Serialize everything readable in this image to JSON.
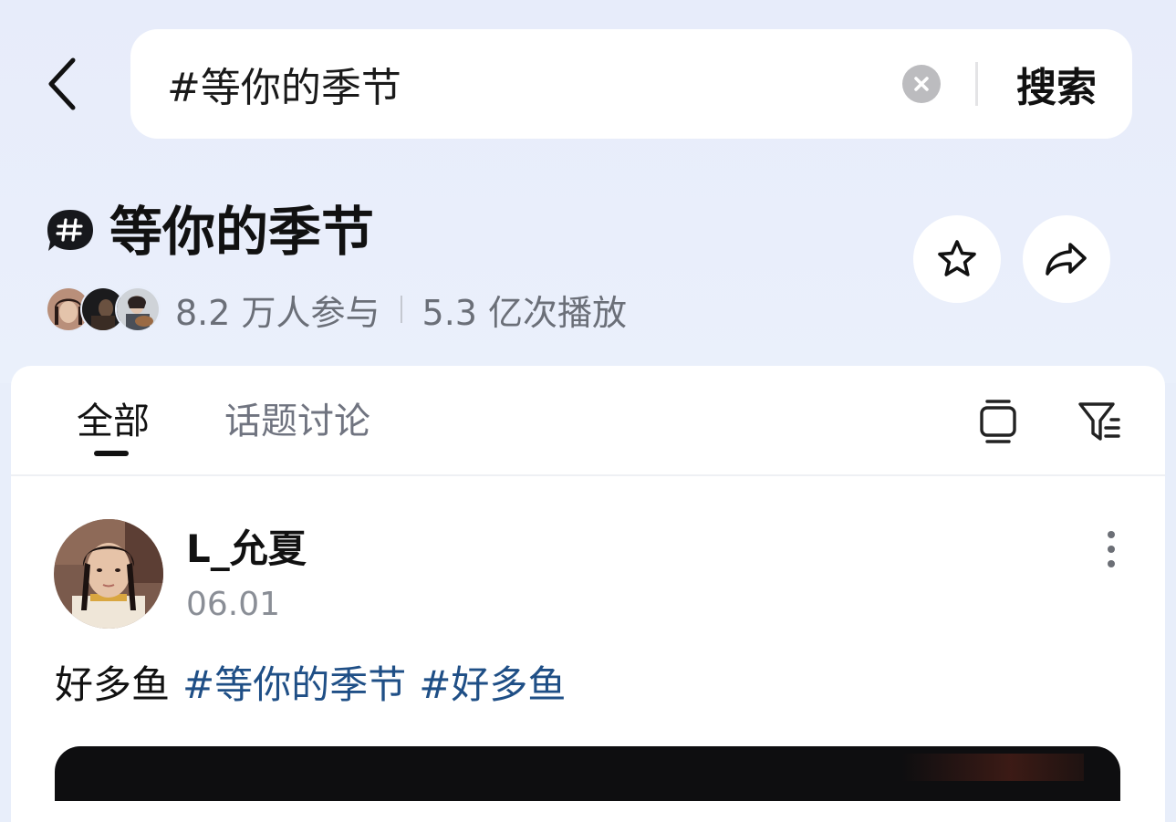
{
  "search": {
    "value": "#等你的季节",
    "button_label": "搜索"
  },
  "topic": {
    "title": "等你的季节",
    "participants": "8.2 万人参与",
    "plays": "5.3 亿次播放"
  },
  "tabs": [
    {
      "label": "全部",
      "active": true
    },
    {
      "label": "话题讨论",
      "active": false
    }
  ],
  "post": {
    "author": "L_允夏",
    "date": "06.01",
    "text": "好多鱼",
    "tags": [
      "#等你的季节",
      "#好多鱼"
    ]
  },
  "colors": {
    "background": "#e8eefa",
    "tag": "#1f4f86",
    "muted_text": "#6b6f78"
  },
  "icons": {
    "back": "chevron-left-icon",
    "clear": "clear-circle-icon",
    "topic": "hashtag-bubble-icon",
    "favorite": "star-icon",
    "share": "share-arrow-icon",
    "layout": "stack-layout-icon",
    "filter": "filter-icon",
    "more": "more-vertical-icon"
  }
}
